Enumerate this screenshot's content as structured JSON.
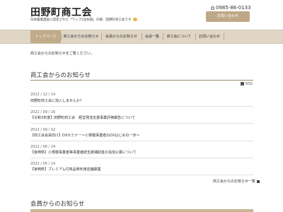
{
  "header": {
    "site_title": "田野町商工会",
    "tagline": "日本農業遺産に認定された「ラップ2台形紙」の郷、田野町商工会です",
    "emoji_icon": "sunglasses-emoji-icon",
    "phone": "0985-86-0133",
    "phone_icon": "phone-icon",
    "contact_button": "お問い合わせ"
  },
  "nav": {
    "items": [
      {
        "label": "トップページ",
        "active": true
      },
      {
        "label": "商工会からのお知らせ",
        "active": false
      },
      {
        "label": "会員からのお知らせ",
        "active": false
      },
      {
        "label": "会員一覧",
        "active": false
      },
      {
        "label": "商工会について",
        "active": false
      },
      {
        "label": "お問い合わせ",
        "active": false
      }
    ]
  },
  "main": {
    "intro": "商工会からのお知らせをご覧ください。",
    "section1_title": "商工会からのお知らせ",
    "rss_label": "RSS",
    "rss_icon": "rss-icon",
    "news": [
      {
        "date": "2022 / 12 / 14",
        "title": "田野町商工会に加入しませんか？"
      },
      {
        "date": "2022 / 09 / 16",
        "title": "【令和3年度】田野町商工会　経営発達支援事業評価報告について"
      },
      {
        "date": "2022 / 09 / 02",
        "title": "【商工会会員向け】DXセミナー～小規模事業者のDXはじめの一歩～"
      },
      {
        "date": "2022 / 06 / 24",
        "title": "【宮崎県】小規模事業者等事業継続支援補助金の追加公募について"
      },
      {
        "date": "2022 / 05 / 14",
        "title": "【宮崎県】プレミアム付商品券利用店舗募集"
      }
    ],
    "list_link": "商工会からのお知らせ一覧",
    "list_link_icon": "arrow-right-icon",
    "section2_title": "会員からのお知らせ"
  }
}
